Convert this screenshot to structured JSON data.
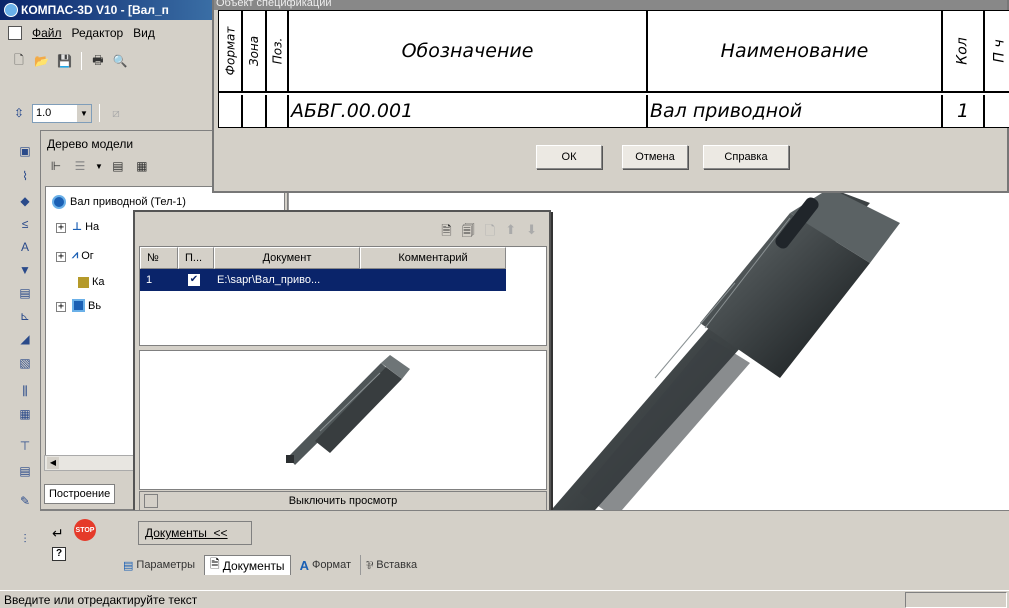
{
  "app": {
    "title": "КОМПАС-3D V10 - [Вал_п"
  },
  "menu": {
    "file": "Файл",
    "edit": "Редактор",
    "view": "Вид"
  },
  "zoom": {
    "value": "1.0"
  },
  "tree": {
    "panel_title": "Дерево модели",
    "root": "Вал приводной (Тел-1)",
    "items": [
      "На",
      "Ог",
      "Ка",
      "Вь"
    ],
    "tab": "Построение"
  },
  "spec": {
    "title": "Объект спецификации",
    "headers": {
      "format": "Формат",
      "zone": "Зона",
      "pos": "Поз.",
      "designation": "Обозначение",
      "name": "Наименование",
      "qty": "Кол",
      "note": "П ч"
    },
    "row": {
      "designation": "АБВГ.00.001",
      "name": "Вал приводной",
      "qty": "1"
    },
    "buttons": {
      "ok": "ОК",
      "cancel": "Отмена",
      "help": "Справка"
    }
  },
  "docs": {
    "columns": [
      "№",
      "П...",
      "Документ",
      "Комментарий"
    ],
    "rows": [
      {
        "num": "1",
        "checked": true,
        "document": "E:\\sapr\\Вал_приво...",
        "comment": ""
      }
    ],
    "preview_toggle": "Выключить просмотр"
  },
  "bottom": {
    "docs_label": "Документы  <<",
    "tabs": [
      "Параметры",
      "Документы",
      "Формат",
      "Вставка"
    ],
    "stop_label": "STOP"
  },
  "status": {
    "text": "Введите или отредактируйте текст"
  },
  "colors": {
    "accent": "#0a246a",
    "face": "#d4d0c8",
    "stop": "#e53a2a"
  }
}
